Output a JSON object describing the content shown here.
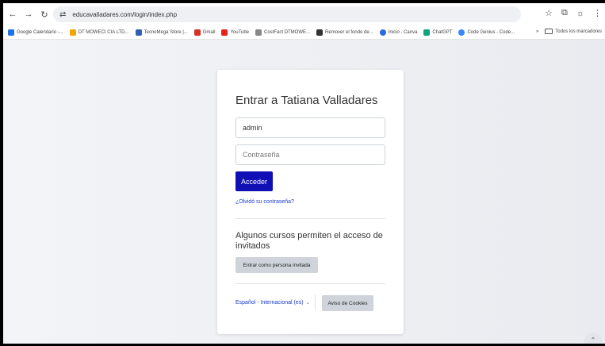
{
  "browser": {
    "url": "educavalladares.com/login/index.php",
    "bookmarks": [
      {
        "label": "Google Calendario -...",
        "color": "#1a73e8"
      },
      {
        "label": "DT MOWECI CIA LTD...",
        "color": "#f2a600"
      },
      {
        "label": "TecnoMega Store |...",
        "color": "#2f62b5"
      },
      {
        "label": "Gmail",
        "color": "#d93025"
      },
      {
        "label": "YouTube",
        "color": "#e62117"
      },
      {
        "label": "CostFact DTMOWE...",
        "color": "#888888"
      },
      {
        "label": "Remover el fondo de...",
        "color": "#333333"
      },
      {
        "label": "Inicio - Canva",
        "color": "#2a6be0"
      },
      {
        "label": "ChatGPT",
        "color": "#10a37f"
      },
      {
        "label": "Code Genius - Code...",
        "color": "#3a86ff"
      }
    ],
    "more_bookmarks": "»",
    "all_bookmarks": "Todos los marcadores"
  },
  "login": {
    "title": "Entrar a Tatiana Valladares",
    "username_value": "admin",
    "password_placeholder": "Contraseña",
    "login_button": "Acceder",
    "forgot_link": "¿Olvidó su contraseña?",
    "guest_text": "Algunos cursos permiten el acceso de invitados",
    "guest_button": "Entrar como persona invitada",
    "language": "Español - Internacional (es)",
    "cookies_button": "Aviso de Cookies"
  },
  "colors": {
    "primary_button": "#0f0fb5",
    "link": "#1a3cc9"
  }
}
